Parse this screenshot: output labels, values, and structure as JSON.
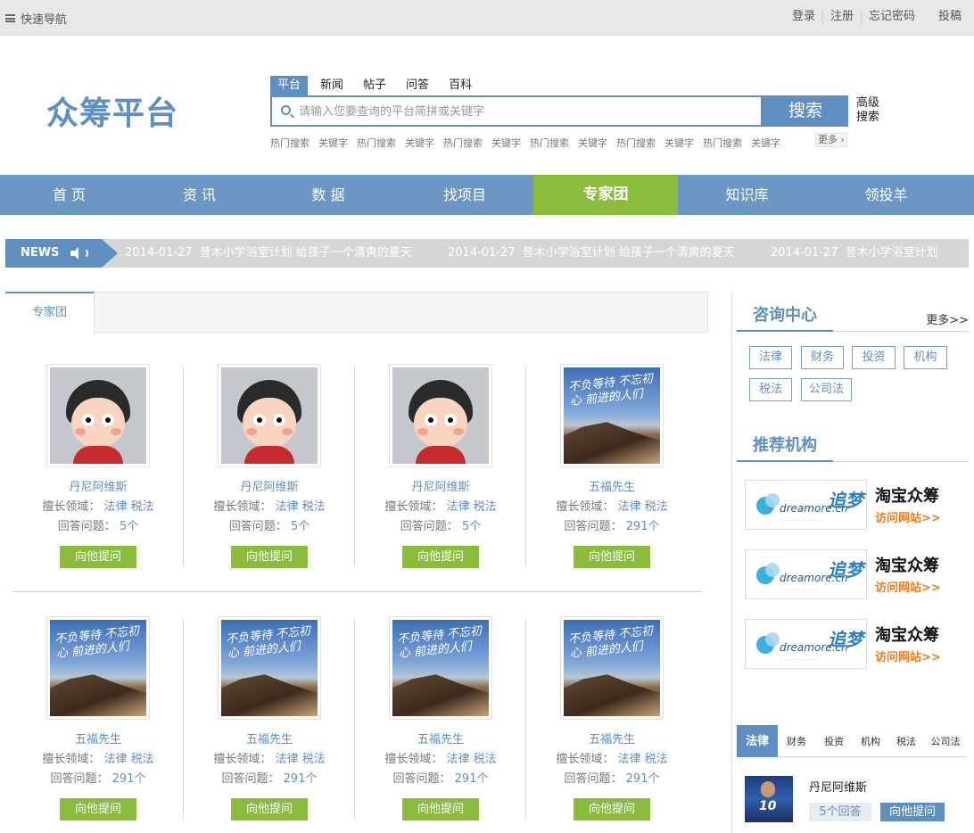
{
  "topbar": {
    "quick_nav": "快速导航",
    "links": [
      "登录",
      "注册",
      "忘记密码",
      "投稿"
    ]
  },
  "header": {
    "logo": "众筹平台",
    "search_tabs": [
      "平台",
      "新闻",
      "帖子",
      "问答",
      "百科"
    ],
    "active_search_tab": "平台",
    "search_placeholder": "请输入您要查询的平台简拼或关键字",
    "search_button": "搜索",
    "advanced_search": "高级搜索",
    "hot_words": [
      "热门搜索",
      "关键字",
      "热门搜索",
      "关键字",
      "热门搜索",
      "关键字",
      "热门搜索",
      "关键字",
      "热门搜索",
      "关键字",
      "热门搜索",
      "关键字"
    ],
    "more": "更多"
  },
  "nav": {
    "items": [
      "首 页",
      "资 讯",
      "数 据",
      "找项目",
      "专家团",
      "知识库",
      "领投羊"
    ],
    "active": "专家团"
  },
  "news": {
    "label": "NEWS",
    "items": [
      {
        "date": "2014-01-27",
        "text": "昔木小学浴室计划 给孩子一个清爽的夏天"
      },
      {
        "date": "2014-01-27",
        "text": "昔木小学浴室计划 给孩子一个清爽的夏天"
      },
      {
        "date": "2014-01-27",
        "text": "昔木小学浴室计划"
      }
    ]
  },
  "experts": {
    "tab": "专家团",
    "field_label": "擅长领域：",
    "count_label": "回答问题：",
    "ask_button": "向他提问",
    "cards": [
      {
        "name": "丹尼阿维斯",
        "fields": "法律 税法",
        "count": "5个",
        "avatar": "cartoon"
      },
      {
        "name": "丹尼阿维斯",
        "fields": "法律 税法",
        "count": "5个",
        "avatar": "cartoon"
      },
      {
        "name": "丹尼阿维斯",
        "fields": "法律 税法",
        "count": "5个",
        "avatar": "cartoon"
      },
      {
        "name": "五福先生",
        "fields": "法律 税法",
        "count": "291个",
        "avatar": "landscape"
      },
      {
        "name": "五福先生",
        "fields": "法律 税法",
        "count": "291个",
        "avatar": "landscape"
      },
      {
        "name": "五福先生",
        "fields": "法律 税法",
        "count": "291个",
        "avatar": "landscape"
      },
      {
        "name": "五福先生",
        "fields": "法律 税法",
        "count": "291个",
        "avatar": "landscape"
      },
      {
        "name": "五福先生",
        "fields": "法律 税法",
        "count": "291个",
        "avatar": "landscape"
      }
    ]
  },
  "sidebar": {
    "consult_title": "咨询中心",
    "more": "更多>>",
    "categories": [
      "法律",
      "财务",
      "投资",
      "机构",
      "税法",
      "公司法"
    ],
    "recommend_title": "推荐机构",
    "orgs": [
      {
        "name": "淘宝众筹",
        "link": "访问网站>>"
      },
      {
        "name": "淘宝众筹",
        "link": "访问网站>>"
      },
      {
        "name": "淘宝众筹",
        "link": "访问网站>>"
      }
    ],
    "bottom_tabs": [
      "法律",
      "财务",
      "投资",
      "机构",
      "税法",
      "公司法"
    ],
    "active_bottom_tab": "法律",
    "qa": {
      "name": "丹尼阿维斯",
      "count": "5个回答",
      "ask": "向他提问"
    }
  },
  "colors": {
    "accent": "#5f8ec0",
    "green": "#8bbc3c",
    "orange": "#f07a1c"
  }
}
